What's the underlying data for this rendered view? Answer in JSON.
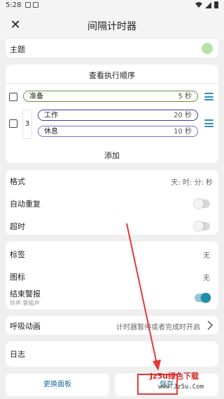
{
  "status_bar": {
    "time": "5:28"
  },
  "app_bar": {
    "title": "间隔计时器"
  },
  "theme": {
    "label": "主题",
    "color": "#b6e3a4"
  },
  "sequence": {
    "title": "查看执行顺序",
    "items": [
      {
        "name": "准备",
        "duration": "5 秒"
      },
      {
        "name": "工作",
        "duration": "20 秒"
      },
      {
        "name": "休息",
        "duration": "10 秒"
      }
    ],
    "loop_count": "3",
    "add_label": "添加"
  },
  "settings": {
    "format_label": "格式",
    "format_value": "天: 时: 分: 秒",
    "auto_repeat_label": "自动重复",
    "auto_repeat_on": false,
    "timeout_label": "超时",
    "timeout_on": false
  },
  "tags": {
    "tag_label": "标签",
    "tag_value": "无",
    "icon_label": "图标",
    "icon_value": "无",
    "end_alarm_label": "结束警报",
    "end_alarm_sub": "铃声:警报声",
    "end_alarm_on": true
  },
  "breath": {
    "label": "呼吸动画",
    "value": "计时器暂停或者完成时开启"
  },
  "log": {
    "label": "日志"
  },
  "buttons": {
    "switch_panel": "更换面板",
    "save": "保存"
  },
  "watermark": {
    "line1": "Jz5u绿色下载",
    "line2": "www.Jz5u.Com"
  },
  "colors": {
    "accent": "#1b8eaa",
    "prepare_border": "#6f8f45",
    "work_border": "#3a3d9e",
    "rest_border": "#8566c9",
    "arrow": "#e53935"
  }
}
